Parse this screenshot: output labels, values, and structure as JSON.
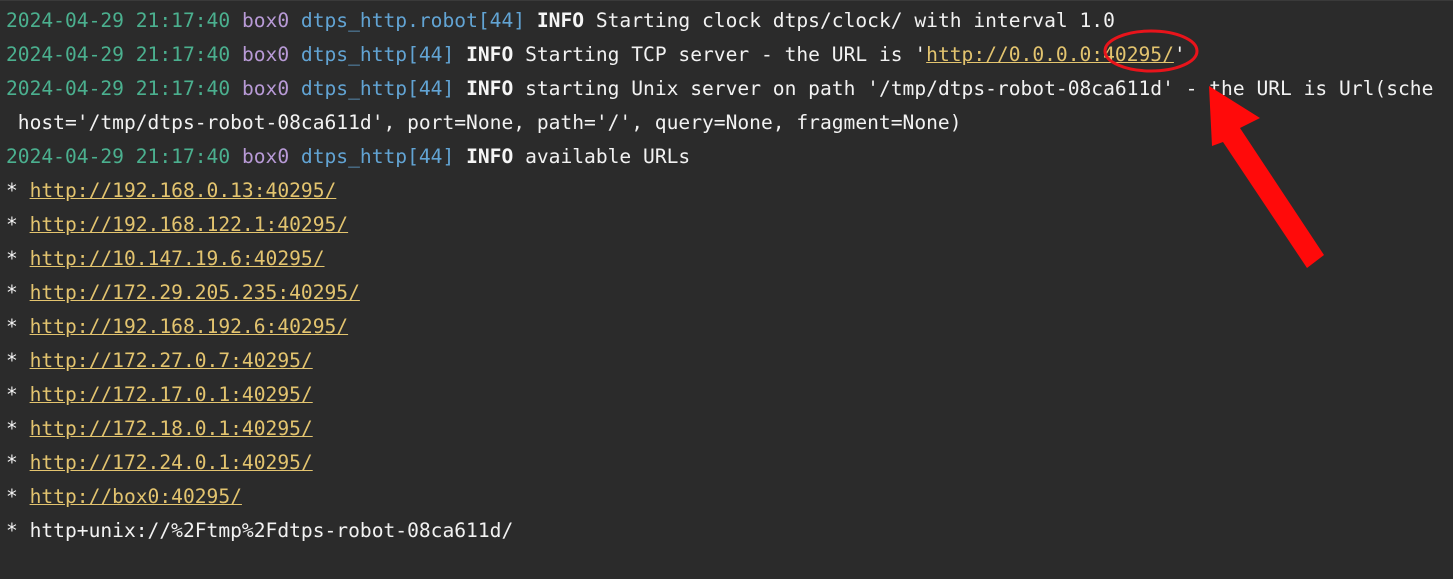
{
  "log": {
    "line1": {
      "timestamp": "2024-04-29 21:17:40",
      "host": "box0",
      "logger": "dtps_http.robot[44]",
      "level": "INFO",
      "message": "Starting clock dtps/clock/ with interval 1.0"
    },
    "line2": {
      "timestamp": "2024-04-29 21:17:40",
      "host": "box0",
      "logger": "dtps_http[44]",
      "level": "INFO",
      "message_prefix": "Starting TCP server - the URL is '",
      "url": "http://0.0.0.0:40295/",
      "message_suffix": "'"
    },
    "line3": {
      "timestamp": "2024-04-29 21:17:40",
      "host": "box0",
      "logger": "dtps_http[44]",
      "level": "INFO",
      "message": "starting Unix server on path '/tmp/dtps-robot-08ca611d' - the URL is Url(sche"
    },
    "line3_continuation": " host='/tmp/dtps-robot-08ca611d', port=None, path='/', query=None, fragment=None)",
    "line4": {
      "timestamp": "2024-04-29 21:17:40",
      "host": "box0",
      "logger": "dtps_http[44]",
      "level": "INFO",
      "message": "available URLs"
    },
    "bullet": "*",
    "urls": [
      "http://192.168.0.13:40295/",
      "http://192.168.122.1:40295/",
      "http://10.147.19.6:40295/",
      "http://172.29.205.235:40295/",
      "http://192.168.192.6:40295/",
      "http://172.27.0.7:40295/",
      "http://172.17.0.1:40295/",
      "http://172.18.0.1:40295/",
      "http://172.24.0.1:40295/",
      "http://box0:40295/"
    ],
    "unix_url": "http+unix://%2Ftmp%2Fdtps-robot-08ca611d/"
  },
  "annotation": {
    "color": "#e8141b",
    "circle_target": "40295",
    "arrow_direction": "up-left"
  },
  "colors": {
    "background": "#2b2b2b",
    "timestamp": "#4bb08f",
    "host": "#b89ad6",
    "logger": "#62a4d4",
    "url": "#e3c46f",
    "text": "#f2f2f2"
  }
}
